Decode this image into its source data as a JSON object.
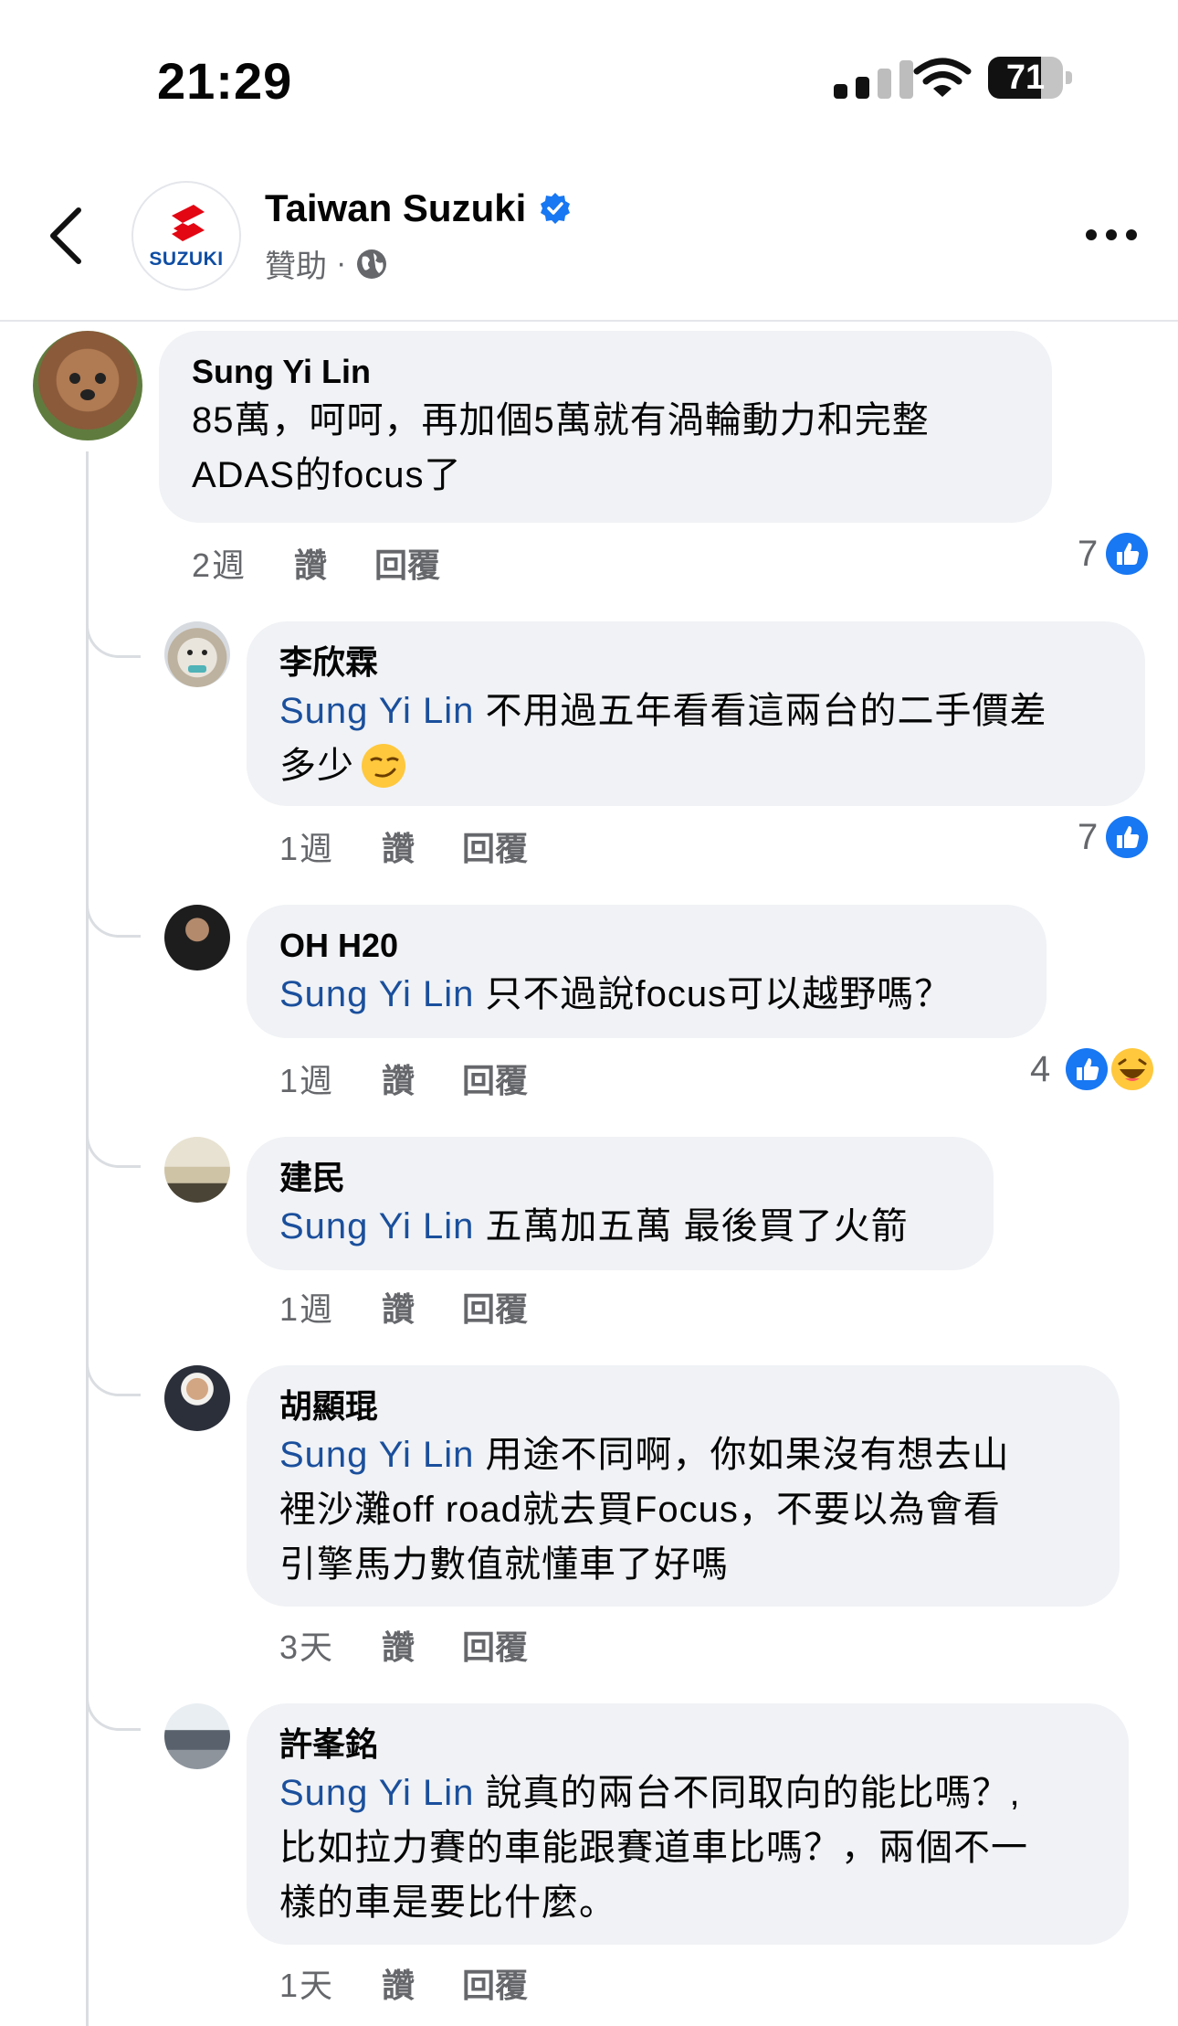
{
  "status_bar": {
    "time": "21:29",
    "battery": "71",
    "battery_level": 0.71
  },
  "header": {
    "page_name": "Taiwan Suzuki",
    "logo_text": "SUZUKI",
    "sponsored": "贊助",
    "separator": "·"
  },
  "comments": [
    {
      "author": "Sung Yi Lin",
      "text_lines": [
        "85萬，呵呵，再加個5萬就有渦輪動力和完整",
        "ADAS的focus了"
      ],
      "time": "2週",
      "like": "讚",
      "reply": "回覆",
      "reaction_count": "7",
      "reactions": [
        "like-icon"
      ]
    }
  ],
  "replies": [
    {
      "author": "李欣霖",
      "mention": "Sung Yi Lin",
      "text_lines": [
        " 不用過五年看看這兩台的二手價差",
        "多少"
      ],
      "emoji": "smirk-emoji",
      "time": "1週",
      "like": "讚",
      "reply": "回覆",
      "reaction_count": "7",
      "reactions": [
        "like-icon"
      ]
    },
    {
      "author": "OH H20",
      "mention": "Sung Yi Lin",
      "text_lines": [
        " 只不過說focus可以越野嗎？"
      ],
      "time": "1週",
      "like": "讚",
      "reply": "回覆",
      "reaction_count": "4",
      "reactions": [
        "like-icon",
        "haha-icon"
      ]
    },
    {
      "author": "建民",
      "mention": "Sung Yi Lin",
      "text_lines": [
        " 五萬加五萬 最後買了火箭"
      ],
      "time": "1週",
      "like": "讚",
      "reply": "回覆"
    },
    {
      "author": "胡顯琨",
      "mention": "Sung Yi Lin",
      "text_lines": [
        " 用途不同啊，你如果沒有想去山",
        "裡沙灘off road就去買Focus，不要以為會看",
        "引擎馬力數值就懂車了好嗎"
      ],
      "time": "3天",
      "like": "讚",
      "reply": "回覆"
    },
    {
      "author": "許峯銘",
      "mention": "Sung Yi Lin",
      "text_lines": [
        " 說真的兩台不同取向的能比嗎？,",
        "比如拉力賽的車能跟賽道車比嗎？，兩個不一",
        "樣的車是要比什麼。"
      ],
      "time": "1天",
      "like": "讚",
      "reply": "回覆"
    }
  ],
  "colors": {
    "mention": "#1a4f9c",
    "bubble": "#f0f2f5",
    "like_blue": "#1877f2",
    "meta_gray": "#65676b",
    "suzuki_red": "#e30613",
    "suzuki_blue": "#0e4da4"
  }
}
